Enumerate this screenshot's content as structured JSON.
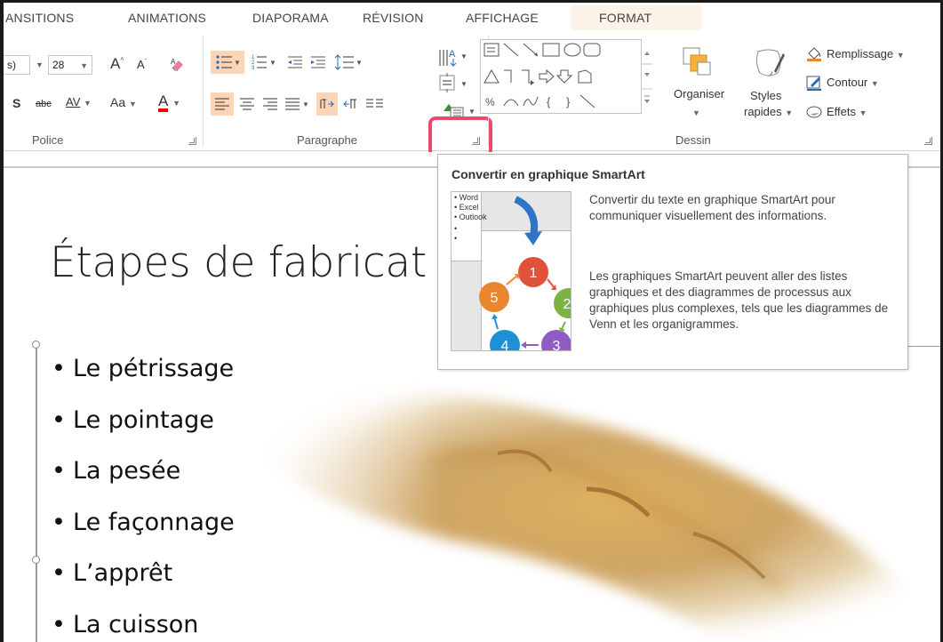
{
  "tabs": {
    "transitions": "ANSITIONS",
    "animations": "ANIMATIONS",
    "diaporama": "DIAPORAMA",
    "revision": "RÉVISION",
    "affichage": "AFFICHAGE",
    "format": "FORMAT"
  },
  "ribbon": {
    "police": {
      "label": "Police",
      "font_name_value": "s)",
      "font_size_value": "28",
      "grow_font": "A",
      "shrink_font": "A",
      "strikethrough": "abc",
      "spacing": "AV",
      "change_case": "Aa",
      "font_color": "A",
      "shadow": "S"
    },
    "paragraphe": {
      "label": "Paragraphe"
    },
    "dessin": {
      "label": "Dessin",
      "organiser": "Organiser",
      "styles_rapides_1": "Styles",
      "styles_rapides_2": "rapides",
      "remplissage": "Remplissage",
      "contour": "Contour",
      "effets": "Effets"
    }
  },
  "tooltip": {
    "title": "Convertir en graphique SmartArt",
    "desc1": "Convertir du texte en graphique SmartArt pour communiquer visuellement des informations.",
    "desc2": "Les graphiques SmartArt peuvent aller des listes graphiques et des diagrammes de processus aux graphiques plus complexes, tels que les diagrammes de Venn et les organigrammes.",
    "image_list": [
      "Word",
      "Excel",
      "Outlook"
    ],
    "cycle_numbers": [
      "1",
      "2",
      "3",
      "4",
      "5"
    ]
  },
  "slide": {
    "title": "Étapes de fabricat",
    "bullets": [
      "Le pétrissage",
      "Le pointage",
      "La pesée",
      "Le façonnage",
      "L’apprêt",
      "La cuisson"
    ]
  },
  "colors": {
    "highlight": "#fcd4b6",
    "smartart_box": "#e84b6b",
    "cycle_1": "#e0523a",
    "cycle_2": "#7cb342",
    "cycle_3": "#8e5cc4",
    "cycle_4": "#1e90d6",
    "cycle_5": "#e8872e",
    "arrow_blue": "#2f75c6"
  }
}
